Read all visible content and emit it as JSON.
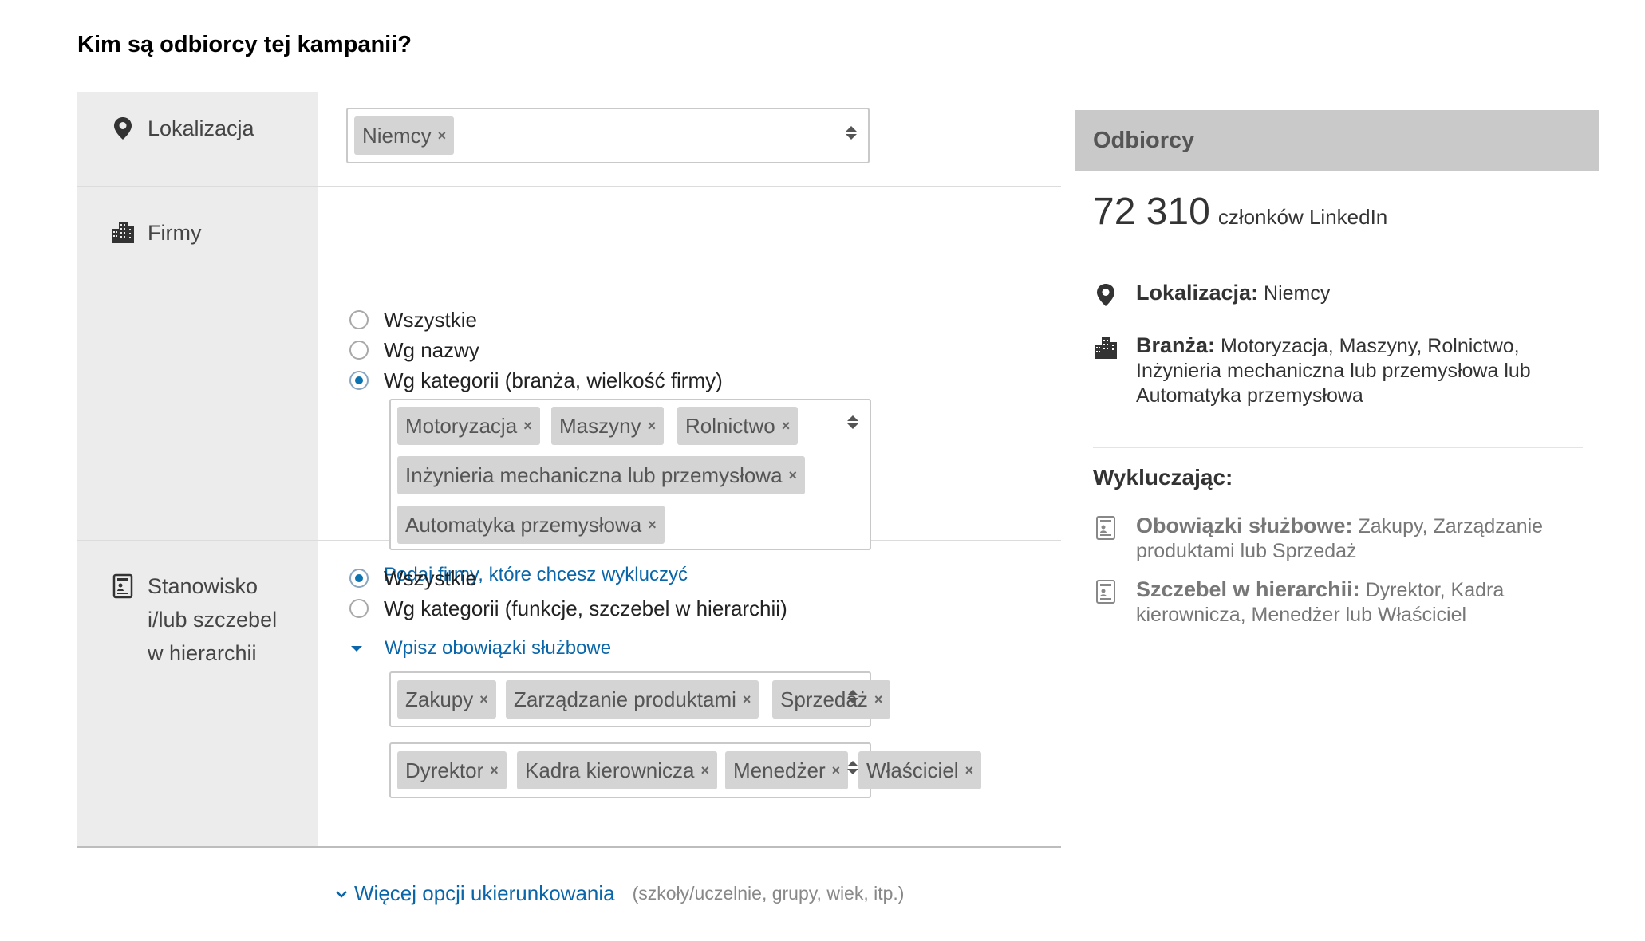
{
  "page": {
    "title": "Kim są odbiorcy tej kampanii?"
  },
  "location": {
    "label": "Lokalizacja",
    "icon": "map-pin-icon",
    "tags": [
      "Niemcy"
    ]
  },
  "companies": {
    "label": "Firmy",
    "icon": "buildings-icon",
    "options": [
      "Wszystkie",
      "Wg nazwy",
      "Wg kategorii (branża, wielkość firmy)"
    ],
    "selected_index": 2,
    "tags": [
      "Motoryzacja",
      "Maszyny",
      "Rolnictwo",
      "Inżynieria mechaniczna lub przemysłowa",
      "Automatyka przemysłowa"
    ],
    "exclude_link": "Podaj firmy, które chcesz wykluczyć"
  },
  "position": {
    "label_lines": [
      "Stanowisko",
      "i/lub szczebel",
      "w hierarchii"
    ],
    "icon": "id-card-icon",
    "options": [
      "Wszystkie",
      "Wg kategorii (funkcje, szczebel w hierarchii)"
    ],
    "selected_index": 0,
    "functions_link": "Wpisz obowiązki służbowe",
    "function_tags": [
      "Zakupy",
      "Zarządzanie produktami",
      "Sprzedaż"
    ],
    "seniority_tags": [
      "Dyrektor",
      "Kadra kierownicza",
      "Menedżer",
      "Właściciel"
    ]
  },
  "more_options": {
    "link": "Więcej opcji ukierunkowania",
    "hint": "(szkoły/uczelnie, grupy, wiek, itp.)"
  },
  "audience": {
    "header": "Odbiorcy",
    "count": "72 310",
    "count_label": "członków LinkedIn",
    "location_key": "Lokalizacja:",
    "location_value": "Niemcy",
    "industry_key": "Branża:",
    "industry_value": "Motoryzacja, Maszyny, Rolnictwo, Inżynieria mechaniczna lub przemysłowa lub Automatyka przemysłowa",
    "excluding_title": "Wykluczając:",
    "functions_key": "Obowiązki służbowe:",
    "functions_value": "Zakupy, Zarządzanie produktami lub Sprzedaż",
    "seniority_key": "Szczebel w hierarchii:",
    "seniority_value": "Dyrektor, Kadra kierownicza, Menedżer lub Właściciel"
  },
  "colors": {
    "link": "#0a66a8",
    "radio_checked": "#0a73b0",
    "tag_bg": "#d4d4d4",
    "label_bg": "#ececec",
    "panel_header_bg": "#c9c9c9"
  }
}
